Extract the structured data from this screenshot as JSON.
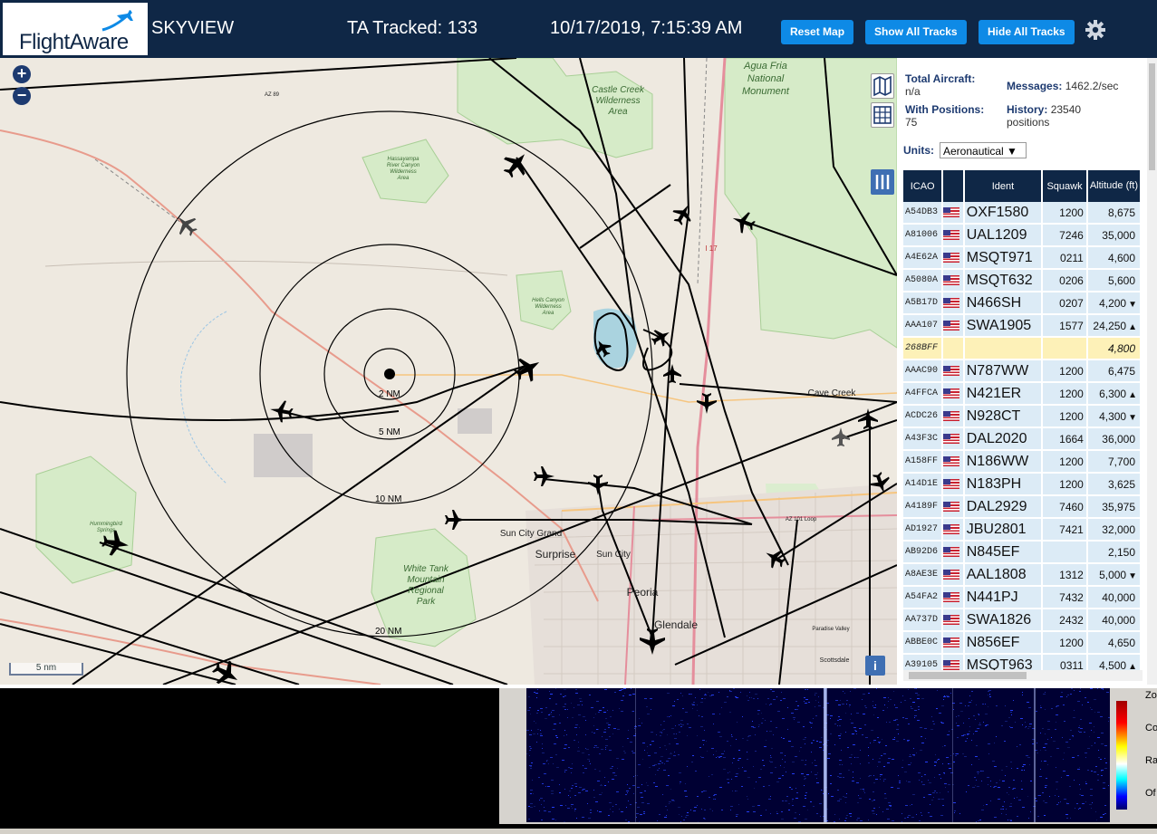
{
  "header": {
    "logo_text": "FlightAware",
    "app_name": "SKYVIEW",
    "tracked": "TA Tracked: 133",
    "datetime": "10/17/2019, 7:15:39 AM",
    "reset_map": "Reset Map",
    "show_all": "Show All Tracks",
    "hide_all": "Hide All Tracks",
    "colors": {
      "header_bg": "#0f2746",
      "button_bg": "#0e8ae6"
    }
  },
  "map": {
    "zoom_in": "+",
    "zoom_out": "−",
    "scale": "5 nm",
    "info": "i",
    "range_rings": [
      "2 NM",
      "5 NM",
      "10 NM",
      "20 NM"
    ],
    "place_labels": {
      "agua_fria": "Agua Fria",
      "agua_fria2": "National",
      "agua_fria3": "Monument",
      "castle_creek": "Castle Creek",
      "castle_creek2": "Wilderness",
      "castle_creek3": "Area",
      "hassayampa": "Hassayampa",
      "hassayampa2": "River Canyon",
      "hassayampa3": "Wilderness",
      "hassayampa4": "Area",
      "hells_canyon": "Hells Canyon",
      "hells_canyon2": "Wilderness",
      "hells_canyon3": "Area",
      "cave_creek": "Cave Creek",
      "sun_city_grand": "Sun City Grand",
      "surprise": "Surprise",
      "sun_city": "Sun City",
      "peoria": "Peoria",
      "glendale": "Glendale",
      "white_tank": "White Tank",
      "white_tank2": "Mountain",
      "white_tank3": "Regional",
      "white_tank4": "Park",
      "hummingbird": "Hummingbird",
      "hummingbird2": "Springs",
      "paradise_valley": "Paradise Valley",
      "scottsdale": "Scottsdale",
      "az89": "AZ 89",
      "i17": "I 17",
      "az101": "AZ 101 Loop"
    }
  },
  "sidebar": {
    "total_aircraft_label": "Total Aircraft:",
    "total_aircraft_value": "n/a",
    "with_positions_label": "With Positions:",
    "with_positions_value": "75",
    "messages_label": "Messages:",
    "messages_value": "1462.2/sec",
    "history_label": "History:",
    "history_value": "23540",
    "history_unit": "positions",
    "units_label": "Units:",
    "units_value": "Aeronautical ▼",
    "columns": [
      "ICAO",
      "",
      "Ident",
      "Squawk",
      "Altitude (ft)"
    ],
    "rows": [
      {
        "icao": "A54DB3",
        "ident": "OXF1580",
        "squawk": "1200",
        "alt": "8,675",
        "trend": ""
      },
      {
        "icao": "A81006",
        "ident": "UAL1209",
        "squawk": "7246",
        "alt": "35,000",
        "trend": ""
      },
      {
        "icao": "A4E62A",
        "ident": "MSQT971",
        "squawk": "0211",
        "alt": "4,600",
        "trend": ""
      },
      {
        "icao": "A5080A",
        "ident": "MSQT632",
        "squawk": "0206",
        "alt": "5,600",
        "trend": ""
      },
      {
        "icao": "A5B17D",
        "ident": "N466SH",
        "squawk": "0207",
        "alt": "4,200",
        "trend": "▼"
      },
      {
        "icao": "AAA107",
        "ident": "SWA1905",
        "squawk": "1577",
        "alt": "24,250",
        "trend": "▲"
      },
      {
        "icao": "268BFF",
        "ident": "",
        "squawk": "",
        "alt": "4,800",
        "trend": "",
        "selected": true
      },
      {
        "icao": "AAAC90",
        "ident": "N787WW",
        "squawk": "1200",
        "alt": "6,475",
        "trend": ""
      },
      {
        "icao": "A4FFCA",
        "ident": "N421ER",
        "squawk": "1200",
        "alt": "6,300",
        "trend": "▲"
      },
      {
        "icao": "ACDC26",
        "ident": "N928CT",
        "squawk": "1200",
        "alt": "4,300",
        "trend": "▼"
      },
      {
        "icao": "A43F3C",
        "ident": "DAL2020",
        "squawk": "1664",
        "alt": "36,000",
        "trend": ""
      },
      {
        "icao": "A158FF",
        "ident": "N186WW",
        "squawk": "1200",
        "alt": "7,700",
        "trend": ""
      },
      {
        "icao": "A14D1E",
        "ident": "N183PH",
        "squawk": "1200",
        "alt": "3,625",
        "trend": ""
      },
      {
        "icao": "A4189F",
        "ident": "DAL2929",
        "squawk": "7460",
        "alt": "35,975",
        "trend": ""
      },
      {
        "icao": "AD1927",
        "ident": "JBU2801",
        "squawk": "7421",
        "alt": "32,000",
        "trend": ""
      },
      {
        "icao": "AB92D6",
        "ident": "N845EF",
        "squawk": "",
        "alt": "2,150",
        "trend": ""
      },
      {
        "icao": "A8AE3E",
        "ident": "AAL1808",
        "squawk": "1312",
        "alt": "5,000",
        "trend": "▼"
      },
      {
        "icao": "A54FA2",
        "ident": "N441PJ",
        "squawk": "7432",
        "alt": "40,000",
        "trend": ""
      },
      {
        "icao": "AA737D",
        "ident": "SWA1826",
        "squawk": "2432",
        "alt": "40,000",
        "trend": ""
      },
      {
        "icao": "ABBE0C",
        "ident": "N856EF",
        "squawk": "1200",
        "alt": "4,650",
        "trend": ""
      },
      {
        "icao": "A39105",
        "ident": "MSQT963",
        "squawk": "0311",
        "alt": "4,500",
        "trend": "▲"
      }
    ]
  },
  "waterfall": {
    "labels": [
      "Zo",
      "Co",
      "Ra",
      "Of"
    ]
  }
}
